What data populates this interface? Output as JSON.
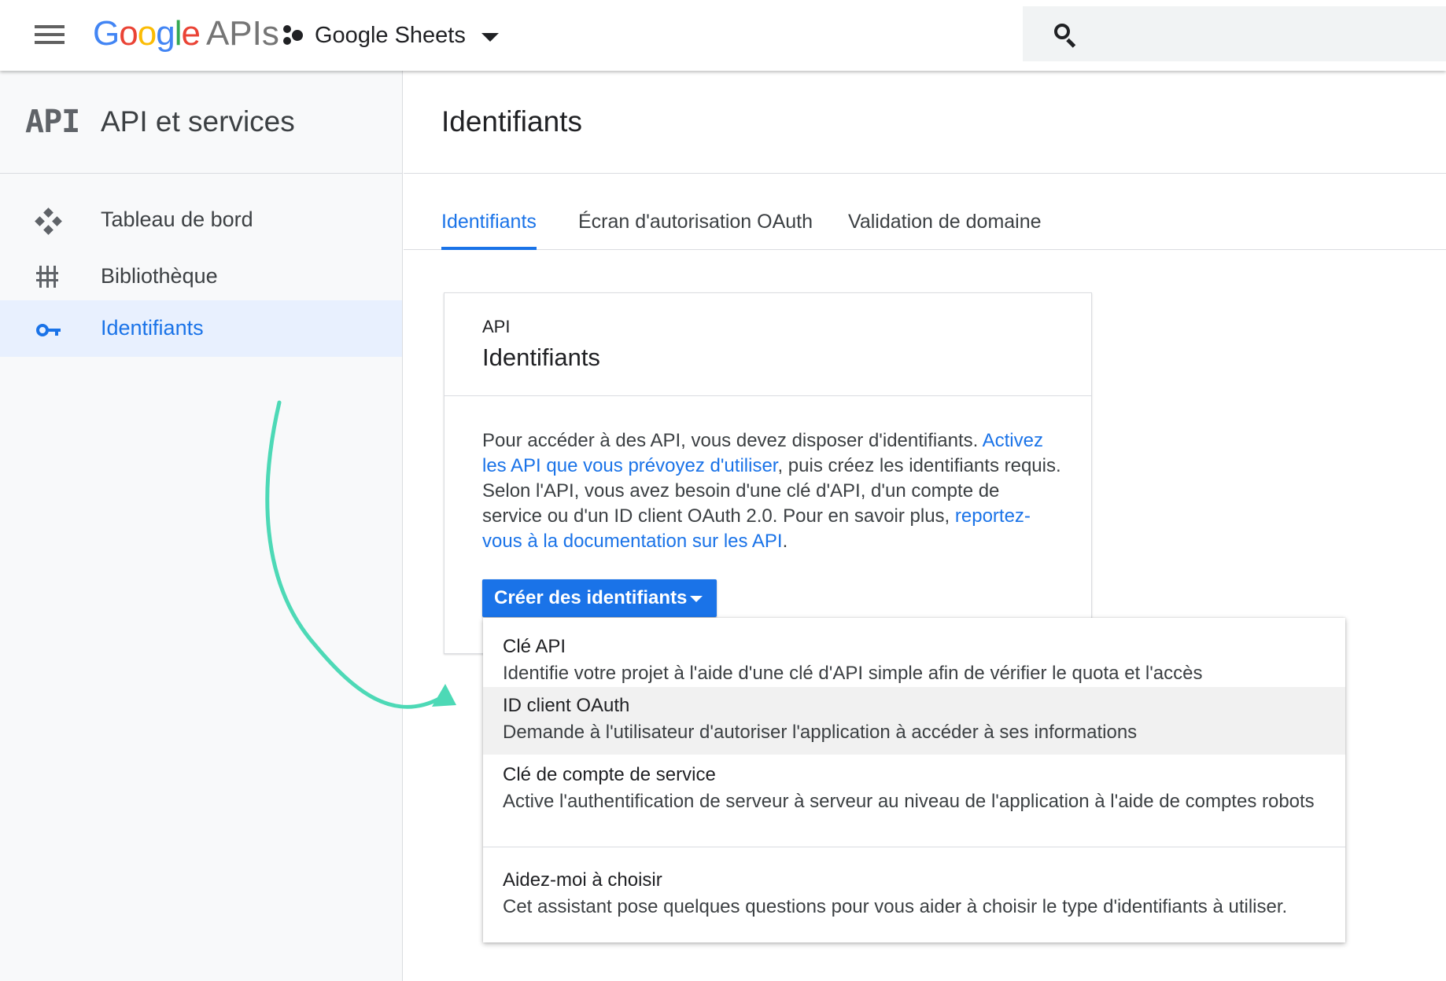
{
  "header": {
    "logo": {
      "g1": "G",
      "g2": "o",
      "g3": "o",
      "g4": "g",
      "g5": "l",
      "g6": "e",
      "apis": "APIs"
    },
    "project_name": "Google Sheets"
  },
  "sidebar": {
    "logo_text": "API",
    "title": "API et services",
    "items": [
      {
        "label": "Tableau de bord",
        "icon": "dashboard-icon"
      },
      {
        "label": "Bibliothèque",
        "icon": "library-icon"
      },
      {
        "label": "Identifiants",
        "icon": "key-icon",
        "active": true
      }
    ]
  },
  "main": {
    "title": "Identifiants",
    "tabs": [
      {
        "label": "Identifiants",
        "active": true
      },
      {
        "label": "Écran d'autorisation OAuth"
      },
      {
        "label": "Validation de domaine"
      }
    ],
    "card": {
      "eyebrow": "API",
      "title": "Identifiants",
      "body": {
        "p1": "Pour accéder à des API, vous devez disposer d'identifiants.",
        "link1": "Activez les API que vous prévoyez d'utiliser",
        "p2": ", puis créez les identifiants requis. Selon l'API, vous avez besoin d'une clé d'API, d'un compte de service ou d'un ID client OAuth 2.0. Pour en savoir plus, ",
        "link2": "reportez-vous à la documentation sur les API",
        "p3": "."
      },
      "create_button": "Créer des identifiants"
    },
    "menu": [
      {
        "title": "Clé API",
        "description": "Identifie votre projet à l'aide d'une clé d'API simple afin de vérifier le quota et l'accès"
      },
      {
        "title": "ID client OAuth",
        "description": "Demande à l'utilisateur d'autoriser l'application à accéder à ses informations",
        "highlighted": true
      },
      {
        "title": "Clé de compte de service",
        "description": "Active l'authentification de serveur à serveur au niveau de l'application à l'aide de comptes robots"
      },
      {
        "title": "Aidez-moi à choisir",
        "description": "Cet assistant pose quelques questions pour vous aider à choisir le type d'identifiants à utiliser."
      }
    ]
  },
  "colors": {
    "accent": "#1a73e8",
    "annotation_arrow": "#4dd9b6",
    "sidebar_active_bg": "#e8f0fe",
    "menu_hover_bg": "#f1f1f1"
  }
}
